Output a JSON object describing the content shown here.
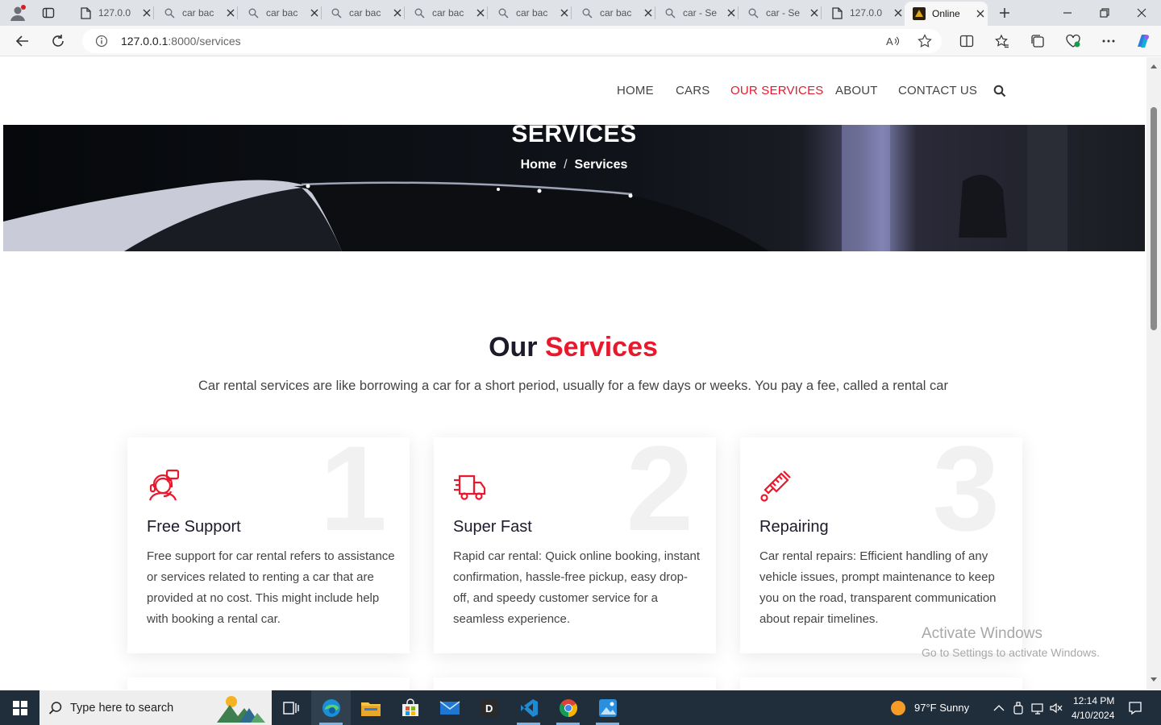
{
  "browser": {
    "tabs": [
      {
        "label": "127.0.0",
        "icon": "page-icon"
      },
      {
        "label": "car bac",
        "icon": "search-icon"
      },
      {
        "label": "car bac",
        "icon": "search-icon"
      },
      {
        "label": "car bac",
        "icon": "search-icon"
      },
      {
        "label": "car bac",
        "icon": "search-icon"
      },
      {
        "label": "car bac",
        "icon": "search-icon"
      },
      {
        "label": "car bac",
        "icon": "search-icon"
      },
      {
        "label": "car - Se",
        "icon": "search-icon"
      },
      {
        "label": "car - Se",
        "icon": "search-icon"
      },
      {
        "label": "127.0.0",
        "icon": "page-icon"
      },
      {
        "label": "Online",
        "icon": "site-icon"
      }
    ],
    "url_host": "127.0.0.1",
    "url_path": ":8000/services"
  },
  "nav": {
    "items": [
      "HOME",
      "CARS",
      "OUR SERVICES",
      "ABOUT",
      "CONTACT US"
    ],
    "active": "OUR SERVICES"
  },
  "hero": {
    "title": "SERVICES",
    "crumb_home": "Home",
    "crumb_sep": "/",
    "crumb_current": "Services"
  },
  "section": {
    "title_a": "Our",
    "title_b": "Services",
    "subtitle": "Car rental services are like borrowing a car for a short period, usually for a few days or weeks. You pay a fee, called a rental car"
  },
  "cards": [
    {
      "number": "1",
      "icon": "support-agent-icon",
      "title": "Free Support",
      "text": "Free support for car rental refers to assistance or services related to renting a car that are provided at no cost. This might include help with booking a rental car."
    },
    {
      "number": "2",
      "icon": "delivery-truck-icon",
      "title": "Super Fast",
      "text": "Rapid car rental: Quick online booking, instant confirmation, hassle-free pickup, easy drop-off, and speedy customer service for a seamless experience."
    },
    {
      "number": "3",
      "icon": "spark-plug-icon",
      "title": "Repairing",
      "text": "Car rental repairs: Efficient handling of any vehicle issues, prompt maintenance to keep you on the road, transparent communication about repair timelines."
    }
  ],
  "watermark": {
    "line1": "Activate Windows",
    "line2": "Go to Settings to activate Windows."
  },
  "taskbar": {
    "search_placeholder": "Type here to search",
    "weather": "97°F  Sunny",
    "time": "12:14 PM",
    "date": "4/10/2024"
  },
  "colors": {
    "accent": "#e8192c",
    "taskbar": "#202d3b"
  }
}
